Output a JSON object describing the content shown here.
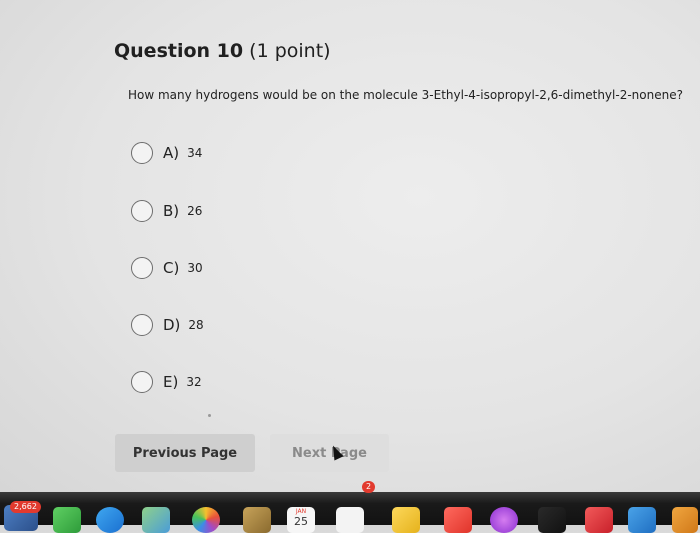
{
  "quiz": {
    "question_number": "Question 10",
    "points": "(1 point)",
    "question_text": "How many hydrogens would be on the molecule 3-Ethyl-4-isopropyl-2,6-dimethyl-2-nonene?",
    "options": [
      {
        "letter": "A)",
        "value": "34"
      },
      {
        "letter": "B)",
        "value": "26"
      },
      {
        "letter": "C)",
        "value": "30"
      },
      {
        "letter": "D)",
        "value": "28"
      },
      {
        "letter": "E)",
        "value": "32"
      }
    ],
    "previous_label": "Previous Page",
    "next_label": "Next Page"
  },
  "dock": {
    "mail_badge": "2,662",
    "calendar_month": "JAN",
    "calendar_day": "25",
    "reminders_badge": "2"
  },
  "colors": {
    "previous_button": "#cfcfcf",
    "next_button": "#dedede",
    "badge": "#e23a2e"
  }
}
